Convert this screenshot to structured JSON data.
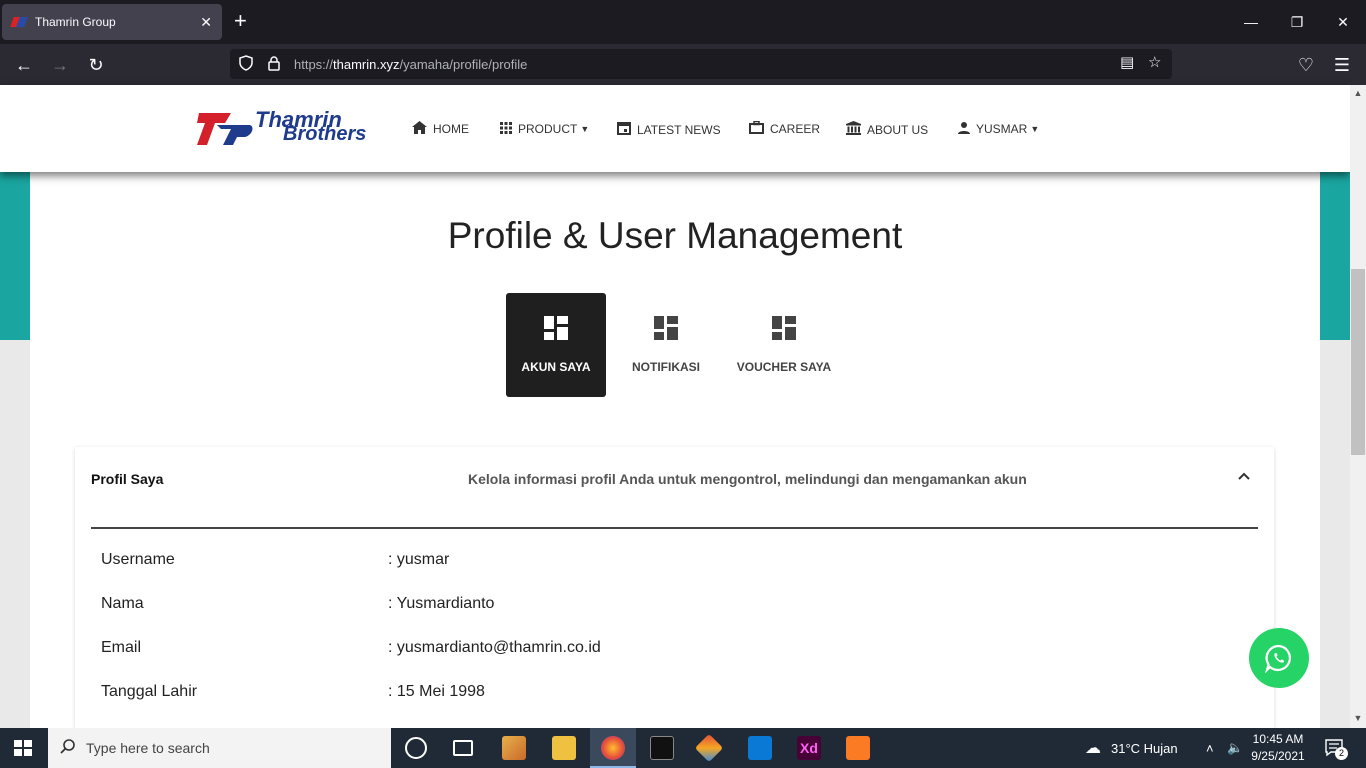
{
  "browser": {
    "tab_title": "Thamrin Group",
    "tab_close": "✕",
    "new_tab": "+",
    "url_prefix": "https://",
    "url_host": "thamrin.xyz",
    "url_path": "/yamaha/profile/profile"
  },
  "site": {
    "logo_line1": "Thamrin",
    "logo_line2": "Brothers",
    "menu": [
      {
        "label": "HOME",
        "icon": "home-icon"
      },
      {
        "label": "PRODUCT",
        "icon": "grid-icon"
      },
      {
        "label": "LATEST NEWS",
        "icon": "calendar-icon"
      },
      {
        "label": "CAREER",
        "icon": "briefcase-icon"
      },
      {
        "label": "ABOUT US",
        "icon": "bank-icon"
      },
      {
        "label": "YUSMAR",
        "icon": "user-icon"
      }
    ]
  },
  "page": {
    "title": "Profile & User Management",
    "tabs": [
      {
        "label": "AKUN SAYA"
      },
      {
        "label": "NOTIFIKASI"
      },
      {
        "label": "VOUCHER SAYA"
      }
    ],
    "card": {
      "title": "Profil Saya",
      "description": "Kelola informasi profil Anda untuk mengontrol, melindungi dan mengamankan akun",
      "rows": [
        {
          "label": "Username",
          "value": ": yusmar"
        },
        {
          "label": "Nama",
          "value": ": Yusmardianto"
        },
        {
          "label": "Email",
          "value": ": yusmardianto@thamrin.co.id"
        },
        {
          "label": "Tanggal Lahir",
          "value": ": 15 Mei 1998"
        }
      ]
    }
  },
  "taskbar": {
    "search_placeholder": "Type here to search",
    "weather": "31°C  Hujan",
    "time": "10:45 AM",
    "date": "9/25/2021",
    "notification_count": "2"
  },
  "colors": {
    "accent_teal": "#1aa5a0",
    "brand_blue": "#1e3b8c",
    "brand_red": "#d4202a",
    "whatsapp": "#25d366"
  }
}
